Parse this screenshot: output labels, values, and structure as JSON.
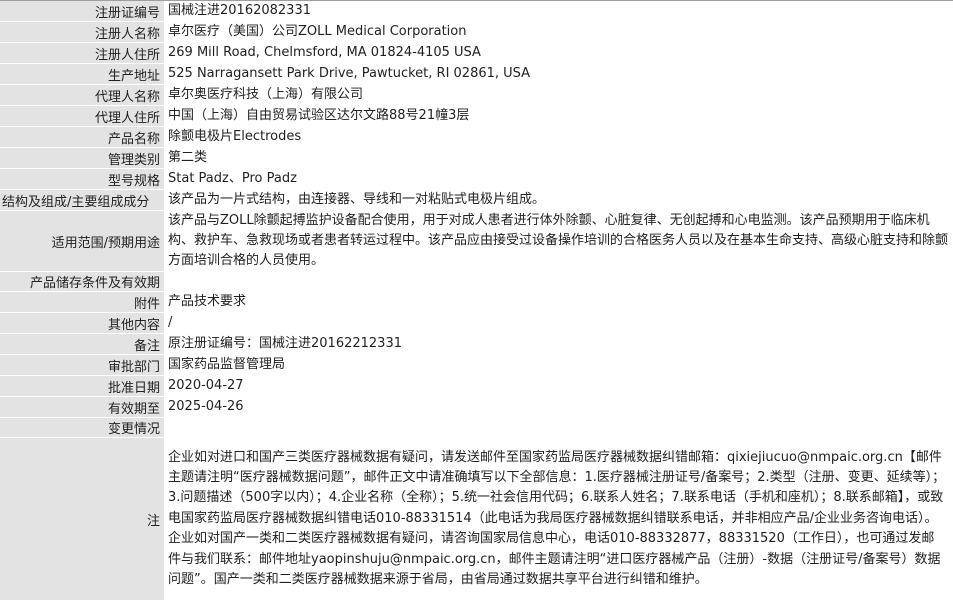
{
  "fields": [
    {
      "label": "注册证编号",
      "value": "国械注进20162082331"
    },
    {
      "label": "注册人名称",
      "value": "卓尔医疗（美国）公司ZOLL Medical Corporation"
    },
    {
      "label": "注册人住所",
      "value": "269 Mill Road, Chelmsford, MA 01824-4105 USA"
    },
    {
      "label": "生产地址",
      "value": "525 Narragansett Park Drive, Pawtucket, RI 02861, USA"
    },
    {
      "label": "代理人名称",
      "value": "卓尔奥医疗科技（上海）有限公司"
    },
    {
      "label": "代理人住所",
      "value": "中国（上海）自由贸易试验区达尔文路88号21幢3层"
    },
    {
      "label": "产品名称",
      "value": "除颤电极片Electrodes"
    },
    {
      "label": "管理类别",
      "value": "第二类"
    },
    {
      "label": "型号规格",
      "value": "Stat Padz、Pro Padz"
    },
    {
      "label": "结构及组成/主要组成成分",
      "value": "该产品为一片式结构，由连接器、导线和一对粘贴式电极片组成。"
    },
    {
      "label": "适用范围/预期用途",
      "value": "该产品与ZOLL除颤起搏监护设备配合使用，用于对成人患者进行体外除颤、心脏复律、无创起搏和心电监测。该产品预期用于临床机构、救护车、急救现场或者患者转运过程中。该产品应由接受过设备操作培训的合格医务人员以及在基本生命支持、高级心脏支持和除颤方面培训合格的人员使用。"
    },
    {
      "label": "产品储存条件及有效期",
      "value": ""
    },
    {
      "label": "附件",
      "value": "产品技术要求"
    },
    {
      "label": "其他内容",
      "value": "/"
    },
    {
      "label": "备注",
      "value": "原注册证编号：国械注进20162212331"
    },
    {
      "label": "审批部门",
      "value": "国家药品监督管理局"
    },
    {
      "label": "批准日期",
      "value": "2020-04-27"
    },
    {
      "label": "有效期至",
      "value": "2025-04-26"
    },
    {
      "label": "变更情况",
      "value": ""
    }
  ],
  "note": {
    "label": "注",
    "text": "企业如对进口和国产三类医疗器械数据有疑问，请发送邮件至国家药监局医疗器械数据纠错邮箱：qixiejiucuo@nmpaic.org.cn【邮件主题请注明“医疗器械数据问题”，邮件正文中请准确填写以下全部信息：1.医疗器械注册证号/备案号；2.类型（注册、变更、延续等）；3.问题描述（500字以内）；4.企业名称（全称）；5.统一社会信用代码；6.联系人姓名；7.联系电话（手机和座机）；8.联系邮箱】，或致电国家药监局医疗器械数据纠错电话010-88331514（此电话为我局医疗器械数据纠错联系电话，并非相应产品/企业业务咨询电话）。企业如对国产一类和二类医疗器械数据有疑问，请咨询国家局信息中心，电话010-88332877，88331520（工作日），也可通过发邮件与我们联系：邮件地址yaopinshuju@nmpaic.org.cn，邮件主题请注明“进口医疗器械产品（注册）-数据（注册证号/备案号）数据问题”。国产一类和二类医疗器械数据来源于省局，由省局通过数据共享平台进行纠错和维护。"
  }
}
